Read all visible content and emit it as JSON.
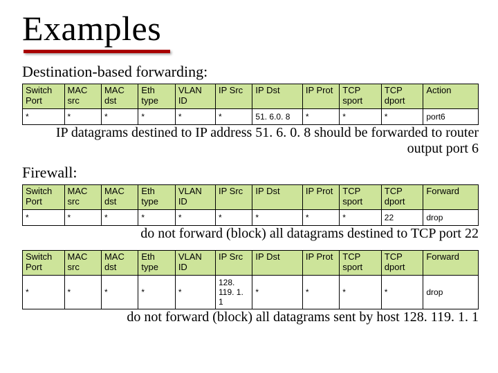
{
  "title": "Examples",
  "section1": "Destination-based forwarding:",
  "section2": "Firewall:",
  "table1": {
    "headers": [
      "Switch Port",
      "MAC src",
      "MAC dst",
      "Eth type",
      "VLAN ID",
      "IP Src",
      "IP Dst",
      "IP Prot",
      "TCP sport",
      "TCP dport",
      "Action"
    ],
    "row": [
      "*",
      "*",
      "*",
      "*",
      "*",
      "*",
      "51. 6.0. 8",
      "*",
      "*",
      "*",
      "port6"
    ]
  },
  "caption1": "IP datagrams destined to IP address 51. 6. 0. 8 should be forwarded to router output port 6",
  "table2": {
    "headers": [
      "Switch Port",
      "MAC src",
      "MAC dst",
      "Eth type",
      "VLAN ID",
      "IP Src",
      "IP Dst",
      "IP Prot",
      "TCP sport",
      "TCP dport",
      "Forward"
    ],
    "row": [
      "*",
      "*",
      "*",
      "*",
      "*",
      "*",
      "*",
      "*",
      "*",
      "22",
      "drop"
    ]
  },
  "caption2": "do not forward (block) all datagrams destined to TCP port 22",
  "table3": {
    "headers": [
      "Switch Port",
      "MAC src",
      "MAC dst",
      "Eth type",
      "VLAN ID",
      "IP Src",
      "IP Dst",
      "IP Prot",
      "TCP sport",
      "TCP dport",
      "Forward"
    ],
    "row": [
      "*",
      "*",
      "*",
      "*",
      "*",
      "128. 119. 1. 1",
      "*",
      "*",
      "*",
      "*",
      "drop"
    ]
  },
  "caption3": "do not forward (block) all datagrams sent by host 128. 119. 1. 1"
}
